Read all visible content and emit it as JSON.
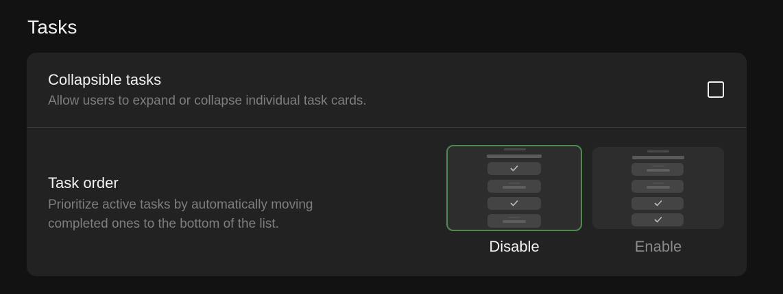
{
  "section": {
    "title": "Tasks"
  },
  "settings": {
    "collapsible": {
      "title": "Collapsible tasks",
      "description": "Allow users to expand or collapse individual task cards.",
      "checked": false
    },
    "task_order": {
      "title": "Task order",
      "description_line1": "Prioritize active tasks by automatically moving",
      "description_line2": "completed ones to the bottom of the list.",
      "options": [
        {
          "label": "Disable",
          "selected": true
        },
        {
          "label": "Enable",
          "selected": false
        }
      ]
    }
  },
  "colors": {
    "accent_selected_border": "#4e8a50",
    "background": "#121212",
    "card": "#222222"
  },
  "icons": [
    "checkbox-icon",
    "check-icon"
  ]
}
